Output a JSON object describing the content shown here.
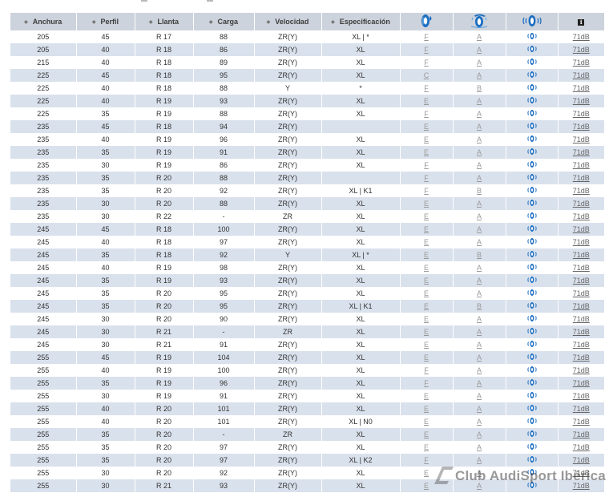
{
  "headers": {
    "width": "Anchura",
    "profile": "Perfil",
    "rim": "Llanta",
    "load": "Carga",
    "speed": "Velocidad",
    "spec": "Especificación",
    "fuel_icon": "fuel-efficiency-tire-icon",
    "wet_icon": "wet-grip-tire-icon",
    "noise_icon": "noise-tire-icon",
    "info_icon": "info-icon",
    "info_glyph": "i"
  },
  "sound_icon": "sound-waves-icon",
  "rows": [
    [
      "205",
      "45",
      "R 17",
      "88",
      "ZR(Y)",
      "XL | *",
      "F",
      "A",
      "71dB"
    ],
    [
      "205",
      "40",
      "R 18",
      "86",
      "ZR(Y)",
      "XL",
      "F",
      "A",
      "71dB"
    ],
    [
      "215",
      "40",
      "R 18",
      "89",
      "ZR(Y)",
      "XL",
      "F",
      "A",
      "71dB"
    ],
    [
      "225",
      "45",
      "R 18",
      "95",
      "ZR(Y)",
      "XL",
      "C",
      "A",
      "71dB"
    ],
    [
      "225",
      "40",
      "R 18",
      "88",
      "Y",
      "*",
      "F",
      "B",
      "71dB"
    ],
    [
      "225",
      "40",
      "R 19",
      "93",
      "ZR(Y)",
      "XL",
      "E",
      "A",
      "71dB"
    ],
    [
      "225",
      "35",
      "R 19",
      "88",
      "ZR(Y)",
      "XL",
      "F",
      "A",
      "71dB"
    ],
    [
      "235",
      "45",
      "R 18",
      "94",
      "ZR(Y)",
      "",
      "E",
      "A",
      "71dB"
    ],
    [
      "235",
      "40",
      "R 19",
      "96",
      "ZR(Y)",
      "XL",
      "E",
      "A",
      "71dB"
    ],
    [
      "235",
      "35",
      "R 19",
      "91",
      "ZR(Y)",
      "XL",
      "E",
      "A",
      "71dB"
    ],
    [
      "235",
      "30",
      "R 19",
      "86",
      "ZR(Y)",
      "XL",
      "F",
      "A",
      "71dB"
    ],
    [
      "235",
      "35",
      "R 20",
      "88",
      "ZR(Y)",
      "",
      "F",
      "A",
      "71dB"
    ],
    [
      "235",
      "35",
      "R 20",
      "92",
      "ZR(Y)",
      "XL | K1",
      "F",
      "B",
      "71dB"
    ],
    [
      "235",
      "30",
      "R 20",
      "88",
      "ZR(Y)",
      "XL",
      "E",
      "A",
      "71dB"
    ],
    [
      "235",
      "30",
      "R 22",
      "-",
      "ZR",
      "XL",
      "E",
      "A",
      "71dB"
    ],
    [
      "245",
      "45",
      "R 18",
      "100",
      "ZR(Y)",
      "XL",
      "E",
      "A",
      "71dB"
    ],
    [
      "245",
      "40",
      "R 18",
      "97",
      "ZR(Y)",
      "XL",
      "E",
      "A",
      "71dB"
    ],
    [
      "245",
      "35",
      "R 18",
      "92",
      "Y",
      "XL | *",
      "E",
      "B",
      "71dB"
    ],
    [
      "245",
      "40",
      "R 19",
      "98",
      "ZR(Y)",
      "XL",
      "E",
      "A",
      "71dB"
    ],
    [
      "245",
      "35",
      "R 19",
      "93",
      "ZR(Y)",
      "XL",
      "E",
      "A",
      "71dB"
    ],
    [
      "245",
      "35",
      "R 20",
      "95",
      "ZR(Y)",
      "XL",
      "E",
      "A",
      "71dB"
    ],
    [
      "245",
      "35",
      "R 20",
      "95",
      "ZR(Y)",
      "XL | K1",
      "E",
      "B",
      "71dB"
    ],
    [
      "245",
      "30",
      "R 20",
      "90",
      "ZR(Y)",
      "XL",
      "E",
      "A",
      "71dB"
    ],
    [
      "245",
      "30",
      "R 21",
      "-",
      "ZR",
      "XL",
      "E",
      "A",
      "71dB"
    ],
    [
      "245",
      "30",
      "R 21",
      "91",
      "ZR(Y)",
      "XL",
      "E",
      "A",
      "71dB"
    ],
    [
      "255",
      "45",
      "R 19",
      "104",
      "ZR(Y)",
      "XL",
      "E",
      "A",
      "71dB"
    ],
    [
      "255",
      "40",
      "R 19",
      "100",
      "ZR(Y)",
      "XL",
      "F",
      "A",
      "71dB"
    ],
    [
      "255",
      "35",
      "R 19",
      "96",
      "ZR(Y)",
      "XL",
      "F",
      "A",
      "71dB"
    ],
    [
      "255",
      "30",
      "R 19",
      "91",
      "ZR(Y)",
      "XL",
      "E",
      "A",
      "71dB"
    ],
    [
      "255",
      "40",
      "R 20",
      "101",
      "ZR(Y)",
      "XL",
      "E",
      "A",
      "71dB"
    ],
    [
      "255",
      "40",
      "R 20",
      "101",
      "ZR(Y)",
      "XL | N0",
      "E",
      "A",
      "71dB"
    ],
    [
      "255",
      "35",
      "R 20",
      "-",
      "ZR",
      "XL",
      "E",
      "A",
      "71dB"
    ],
    [
      "255",
      "35",
      "R 20",
      "97",
      "ZR(Y)",
      "XL",
      "E",
      "A",
      "71dB"
    ],
    [
      "255",
      "35",
      "R 20",
      "97",
      "ZR(Y)",
      "XL | K2",
      "F",
      "A",
      "71dB"
    ],
    [
      "255",
      "30",
      "R 20",
      "92",
      "ZR(Y)",
      "XL",
      "E",
      "A",
      "71dB"
    ],
    [
      "255",
      "30",
      "R 21",
      "93",
      "ZR(Y)",
      "XL",
      "E",
      "A",
      "71dB"
    ]
  ],
  "watermark": {
    "text": "Club AudiSport Ibérica"
  }
}
